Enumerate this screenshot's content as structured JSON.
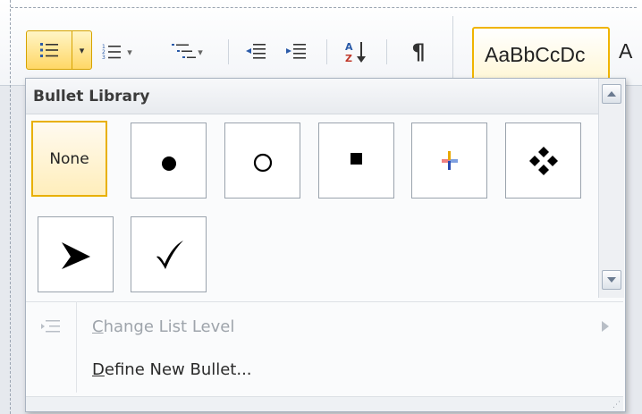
{
  "ribbon": {
    "style_preview": "AaBbCcDc",
    "style_clip": "A",
    "dropdown_arrow": "▾",
    "pilcrow": "¶"
  },
  "panel": {
    "header": "Bullet Library",
    "tiles": [
      {
        "id": "none",
        "label": "None"
      },
      {
        "id": "filled-circle",
        "icon": "filled-circle-bullet-icon"
      },
      {
        "id": "hollow-circle",
        "icon": "hollow-circle-bullet-icon"
      },
      {
        "id": "filled-square",
        "icon": "filled-square-bullet-icon"
      },
      {
        "id": "colored-arrows",
        "icon": "colored-arrows-bullet-icon"
      },
      {
        "id": "four-diamonds",
        "icon": "four-diamonds-bullet-icon"
      },
      {
        "id": "arrowhead",
        "icon": "arrowhead-bullet-icon"
      },
      {
        "id": "checkmark",
        "icon": "checkmark-bullet-icon"
      }
    ],
    "menu": {
      "change_level_pre": "",
      "change_level_key": "C",
      "change_level_rest": "hange List Level",
      "define_key": "D",
      "define_rest": "efine New Bullet..."
    }
  },
  "colors": {
    "selected_border": "#e8b000",
    "selected_fill": "#ffeebb",
    "disabled_text": "#9ea4ab"
  }
}
